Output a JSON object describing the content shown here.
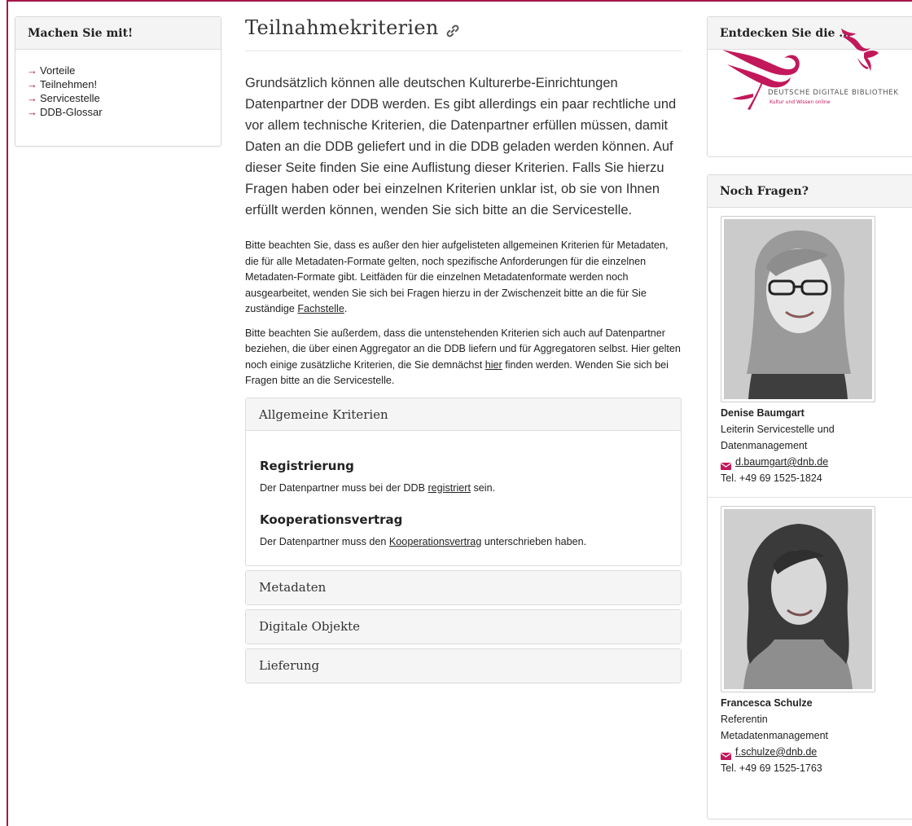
{
  "sidebar": {
    "title": "Machen Sie mit!",
    "items": [
      {
        "label": "Vorteile"
      },
      {
        "label": "Teilnehmen!"
      },
      {
        "label": "Servicestelle"
      },
      {
        "label": "DDB-Glossar"
      }
    ]
  },
  "main": {
    "title": "Teilnahmekriterien",
    "lead": "Grundsätzlich können alle deutschen Kulturerbe-Einrichtungen Datenpartner der DDB werden. Es gibt allerdings ein paar rechtliche und vor allem technische Kriterien, die Datenpartner erfüllen müssen, damit Daten an die DDB geliefert und in die DDB geladen werden können. Auf dieser Seite finden Sie eine Auflistung dieser Kriterien. Falls Sie hierzu Fragen haben oder bei einzelnen Kriterien unklar ist, ob sie von Ihnen erfüllt werden können, wenden Sie sich bitte an die Servicestelle.",
    "para1_before": "Bitte beachten Sie, dass es außer den hier aufgelisteten allgemeinen Kriterien für Metadaten, die für alle Metadaten-Formate gelten, noch spezifische Anforderungen für die einzelnen Metadaten-Formate gibt. Leitfäden für die einzelnen Metadatenformate werden noch ausgearbeitet, wenden Sie sich bei Fragen hierzu in der Zwischenzeit bitte an die für Sie zuständige ",
    "para1_link": "Fachstelle",
    "para1_after": ".",
    "para2_before": "Bitte beachten Sie außerdem, dass die untenstehenden Kriterien sich auch auf Datenpartner beziehen, die über einen Aggregator an die DDB liefern und für Aggregatoren selbst. Hier gelten noch einige zusätzliche Kriterien, die Sie demnächst ",
    "para2_link": "hier",
    "para2_after": " finden werden. Wenden Sie sich bei Fragen bitte an die Servicestelle.",
    "accordion": [
      {
        "title": "Allgemeine Kriterien",
        "sections": [
          {
            "heading": "Registrierung",
            "before": "Der Datenpartner muss bei der DDB ",
            "link": "registriert",
            "after": " sein."
          },
          {
            "heading": "Kooperationsvertrag",
            "before": "Der Datenpartner muss den ",
            "link": "Kooperationsvertrag",
            "after": " unterschrieben haben."
          }
        ]
      },
      {
        "title": "Metadaten"
      },
      {
        "title": "Digitale Objekte"
      },
      {
        "title": "Lieferung"
      }
    ]
  },
  "right": {
    "discover_title": "Entdecken Sie die ...",
    "logo_line1": "DEUTSCHE DIGITALE BIBLIOTHEK",
    "logo_line2": "Kultur und Wissen online",
    "questions_title": "Noch Fragen?",
    "contacts": [
      {
        "name": "Denise Baumgart",
        "role_line1": "Leiterin Servicestelle und",
        "role_line2": "Datenmanagement",
        "email": "d.baumgart@dnb.de",
        "phone": "Tel. +49 69 1525-1824"
      },
      {
        "name": "Francesca Schulze",
        "role_line1": "Referentin",
        "role_line2": "Metadatenmanagement",
        "email": "f.schulze@dnb.de",
        "phone": "Tel. +49 69 1525-1763"
      }
    ]
  },
  "colors": {
    "accent": "#a5174b",
    "panel_bg": "#f4f4f4",
    "border": "#d9d9d9"
  }
}
